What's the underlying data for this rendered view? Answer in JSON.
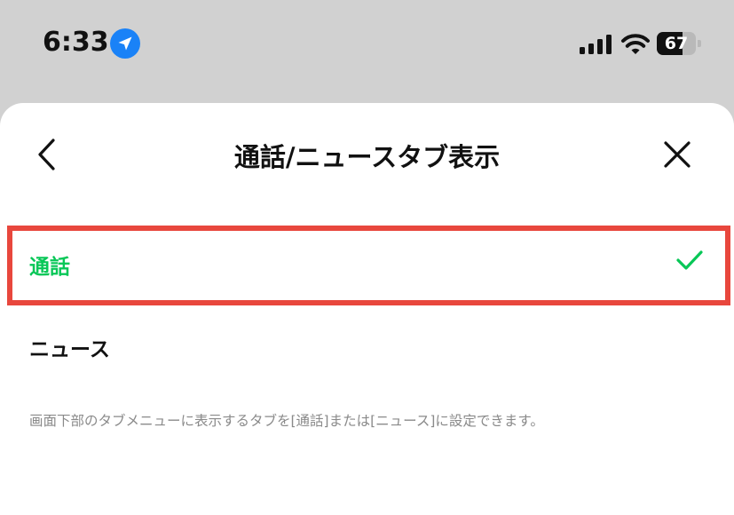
{
  "status_bar": {
    "time": "6:33",
    "battery": "67",
    "battery_level": 0.67,
    "icons": [
      "location-arrow-icon",
      "signal-icon",
      "wifi-icon",
      "battery-icon"
    ]
  },
  "header": {
    "title": "通話/ニュースタブ表示",
    "back_icon": "chevron-left-icon",
    "close_icon": "close-icon"
  },
  "options": [
    {
      "label": "通話",
      "selected": true
    },
    {
      "label": "ニュース",
      "selected": false
    }
  ],
  "description": "画面下部のタブメニューに表示するタブを[通話]または[ニュース]に設定できます。",
  "colors": {
    "accent": "#08c757",
    "highlight_border": "#e8473d",
    "overlay": "#d1d1d1",
    "text": "#111111",
    "muted": "#8a8a8a"
  }
}
